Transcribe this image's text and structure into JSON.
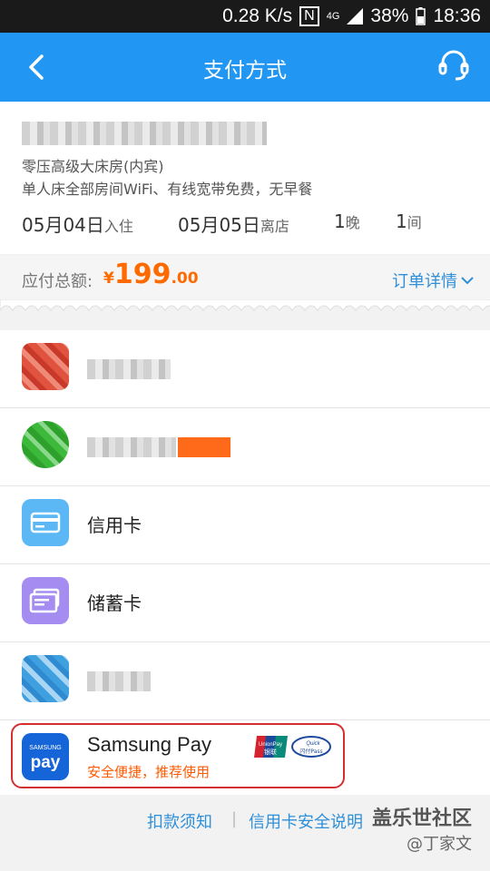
{
  "status_bar": {
    "speed": "0.28 K/s",
    "network": "4G",
    "battery": "38%",
    "time": "18:36"
  },
  "app_bar": {
    "title": "支付方式"
  },
  "order": {
    "room": "零压高级大床房(内宾)",
    "description": "单人床全部房间WiFi、有线宽带免费，无早餐",
    "checkin_date": "05月04日",
    "checkin_label": "入住",
    "checkout_date": "05月05日",
    "checkout_label": "离店",
    "nights_num": "1",
    "nights_unit": "晚",
    "rooms_num": "1",
    "rooms_unit": "间"
  },
  "amount": {
    "label": "应付总额:",
    "currency": "¥",
    "integer": "199",
    "decimal": ".00",
    "details_link": "订单详情"
  },
  "payments": [
    {
      "icon": "blurred-payment-icon",
      "label": ""
    },
    {
      "icon": "blurred-wechat-icon",
      "label": ""
    },
    {
      "icon": "credit-card-icon",
      "label": "信用卡",
      "color": "#3fa9f5"
    },
    {
      "icon": "debit-card-icon",
      "label": "储蓄卡",
      "color": "#9b7fe6"
    },
    {
      "icon": "blurred-payment-icon",
      "label": ""
    }
  ],
  "samsung_pay": {
    "title": "Samsung Pay",
    "subtitle": "安全便捷，推荐使用",
    "logo_lines": [
      "SAMSUNG",
      "pay"
    ],
    "unionpay_lines": [
      "UnionPay",
      "银联"
    ],
    "quickpass_lines": [
      "Quick",
      "闪付Pass"
    ]
  },
  "footer": {
    "link1": "扣款须知",
    "separator": "|",
    "link2": "信用卡安全说明"
  },
  "watermark": {
    "line1": "盖乐世社区",
    "line2": "@丁家文"
  },
  "colors": {
    "primary": "#2196f3",
    "accent": "#ff6a00",
    "link": "#2f8fd8",
    "highlight": "#d32f2f"
  }
}
